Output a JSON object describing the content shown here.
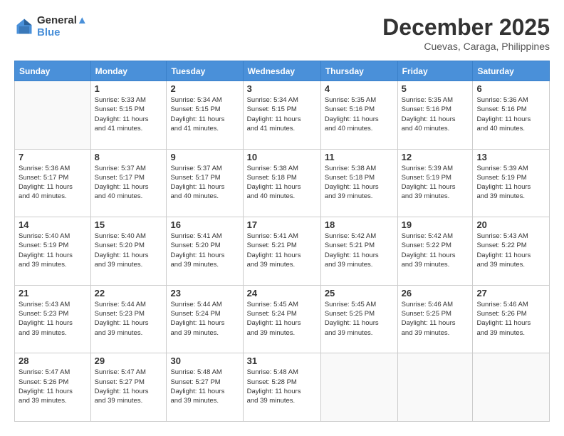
{
  "header": {
    "logo": {
      "line1": "General",
      "line2": "Blue"
    },
    "title": "December 2025",
    "subtitle": "Cuevas, Caraga, Philippines"
  },
  "calendar": {
    "days_of_week": [
      "Sunday",
      "Monday",
      "Tuesday",
      "Wednesday",
      "Thursday",
      "Friday",
      "Saturday"
    ],
    "weeks": [
      [
        {
          "day": "",
          "info": ""
        },
        {
          "day": "1",
          "info": "Sunrise: 5:33 AM\nSunset: 5:15 PM\nDaylight: 11 hours\nand 41 minutes."
        },
        {
          "day": "2",
          "info": "Sunrise: 5:34 AM\nSunset: 5:15 PM\nDaylight: 11 hours\nand 41 minutes."
        },
        {
          "day": "3",
          "info": "Sunrise: 5:34 AM\nSunset: 5:15 PM\nDaylight: 11 hours\nand 41 minutes."
        },
        {
          "day": "4",
          "info": "Sunrise: 5:35 AM\nSunset: 5:16 PM\nDaylight: 11 hours\nand 40 minutes."
        },
        {
          "day": "5",
          "info": "Sunrise: 5:35 AM\nSunset: 5:16 PM\nDaylight: 11 hours\nand 40 minutes."
        },
        {
          "day": "6",
          "info": "Sunrise: 5:36 AM\nSunset: 5:16 PM\nDaylight: 11 hours\nand 40 minutes."
        }
      ],
      [
        {
          "day": "7",
          "info": "Sunrise: 5:36 AM\nSunset: 5:17 PM\nDaylight: 11 hours\nand 40 minutes."
        },
        {
          "day": "8",
          "info": "Sunrise: 5:37 AM\nSunset: 5:17 PM\nDaylight: 11 hours\nand 40 minutes."
        },
        {
          "day": "9",
          "info": "Sunrise: 5:37 AM\nSunset: 5:17 PM\nDaylight: 11 hours\nand 40 minutes."
        },
        {
          "day": "10",
          "info": "Sunrise: 5:38 AM\nSunset: 5:18 PM\nDaylight: 11 hours\nand 40 minutes."
        },
        {
          "day": "11",
          "info": "Sunrise: 5:38 AM\nSunset: 5:18 PM\nDaylight: 11 hours\nand 39 minutes."
        },
        {
          "day": "12",
          "info": "Sunrise: 5:39 AM\nSunset: 5:19 PM\nDaylight: 11 hours\nand 39 minutes."
        },
        {
          "day": "13",
          "info": "Sunrise: 5:39 AM\nSunset: 5:19 PM\nDaylight: 11 hours\nand 39 minutes."
        }
      ],
      [
        {
          "day": "14",
          "info": "Sunrise: 5:40 AM\nSunset: 5:19 PM\nDaylight: 11 hours\nand 39 minutes."
        },
        {
          "day": "15",
          "info": "Sunrise: 5:40 AM\nSunset: 5:20 PM\nDaylight: 11 hours\nand 39 minutes."
        },
        {
          "day": "16",
          "info": "Sunrise: 5:41 AM\nSunset: 5:20 PM\nDaylight: 11 hours\nand 39 minutes."
        },
        {
          "day": "17",
          "info": "Sunrise: 5:41 AM\nSunset: 5:21 PM\nDaylight: 11 hours\nand 39 minutes."
        },
        {
          "day": "18",
          "info": "Sunrise: 5:42 AM\nSunset: 5:21 PM\nDaylight: 11 hours\nand 39 minutes."
        },
        {
          "day": "19",
          "info": "Sunrise: 5:42 AM\nSunset: 5:22 PM\nDaylight: 11 hours\nand 39 minutes."
        },
        {
          "day": "20",
          "info": "Sunrise: 5:43 AM\nSunset: 5:22 PM\nDaylight: 11 hours\nand 39 minutes."
        }
      ],
      [
        {
          "day": "21",
          "info": "Sunrise: 5:43 AM\nSunset: 5:23 PM\nDaylight: 11 hours\nand 39 minutes."
        },
        {
          "day": "22",
          "info": "Sunrise: 5:44 AM\nSunset: 5:23 PM\nDaylight: 11 hours\nand 39 minutes."
        },
        {
          "day": "23",
          "info": "Sunrise: 5:44 AM\nSunset: 5:24 PM\nDaylight: 11 hours\nand 39 minutes."
        },
        {
          "day": "24",
          "info": "Sunrise: 5:45 AM\nSunset: 5:24 PM\nDaylight: 11 hours\nand 39 minutes."
        },
        {
          "day": "25",
          "info": "Sunrise: 5:45 AM\nSunset: 5:25 PM\nDaylight: 11 hours\nand 39 minutes."
        },
        {
          "day": "26",
          "info": "Sunrise: 5:46 AM\nSunset: 5:25 PM\nDaylight: 11 hours\nand 39 minutes."
        },
        {
          "day": "27",
          "info": "Sunrise: 5:46 AM\nSunset: 5:26 PM\nDaylight: 11 hours\nand 39 minutes."
        }
      ],
      [
        {
          "day": "28",
          "info": "Sunrise: 5:47 AM\nSunset: 5:26 PM\nDaylight: 11 hours\nand 39 minutes."
        },
        {
          "day": "29",
          "info": "Sunrise: 5:47 AM\nSunset: 5:27 PM\nDaylight: 11 hours\nand 39 minutes."
        },
        {
          "day": "30",
          "info": "Sunrise: 5:48 AM\nSunset: 5:27 PM\nDaylight: 11 hours\nand 39 minutes."
        },
        {
          "day": "31",
          "info": "Sunrise: 5:48 AM\nSunset: 5:28 PM\nDaylight: 11 hours\nand 39 minutes."
        },
        {
          "day": "",
          "info": ""
        },
        {
          "day": "",
          "info": ""
        },
        {
          "day": "",
          "info": ""
        }
      ]
    ]
  }
}
